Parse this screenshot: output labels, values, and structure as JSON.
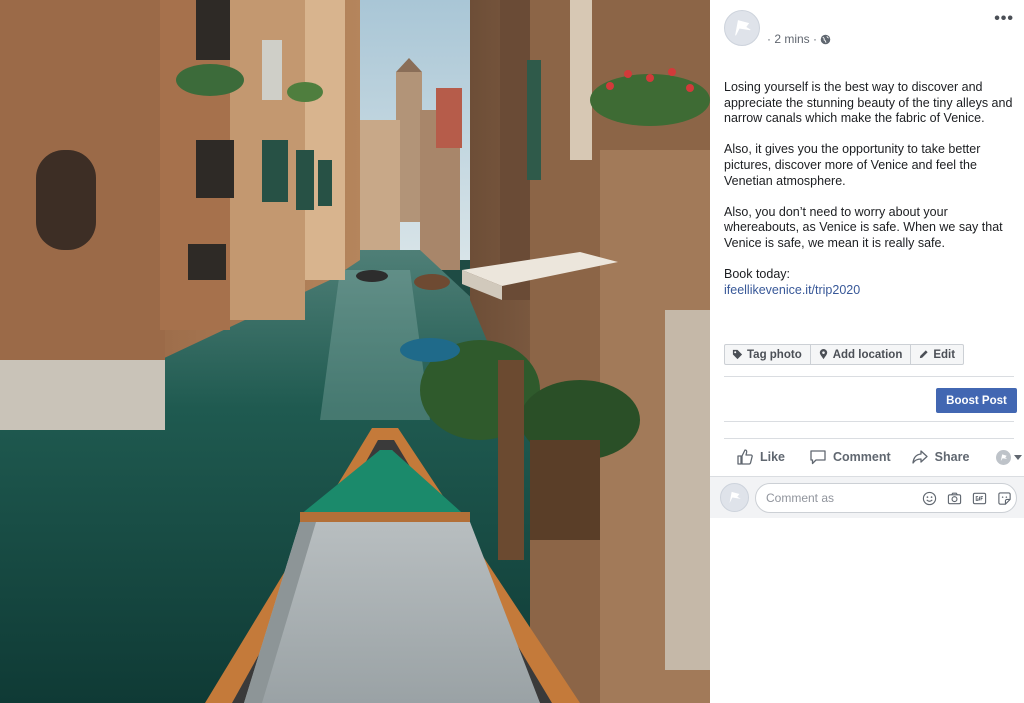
{
  "photo": {
    "alt": "Venice canal with boat"
  },
  "post": {
    "time": "· 2 mins ·",
    "privacy_icon": "globe-icon",
    "menu_label": "•••",
    "paragraphs": [
      "Losing yourself is the best way to discover and appreciate the stunning beauty of the tiny alleys and narrow canals which make the fabric of Venice.",
      "Also, it gives you the opportunity to take better pictures, discover more of Venice and feel the Venetian atmosphere.",
      "Also, you don’t need to worry about your whereabouts, as Venice is safe. When we say that Venice is safe, we mean it is really safe."
    ],
    "book_label": "Book today:",
    "link": "ifeellikevenice.it/trip2020"
  },
  "photo_actions": {
    "tag": "Tag photo",
    "location": "Add location",
    "edit": "Edit"
  },
  "boost": {
    "label": "Boost Post"
  },
  "reactions": {
    "like": "Like",
    "comment": "Comment",
    "share": "Share"
  },
  "comment_box": {
    "placeholder": "Comment as"
  },
  "colors": {
    "accent": "#4267b2",
    "link": "#385898",
    "muted": "#606770",
    "divider": "#dadde1"
  }
}
